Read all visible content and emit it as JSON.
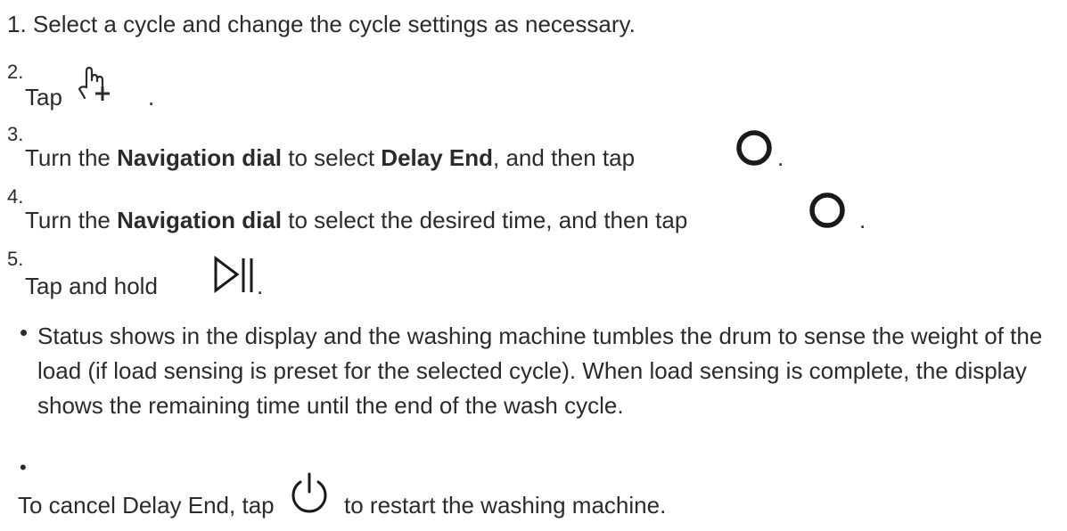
{
  "steps": [
    {
      "num": "1.",
      "text": "Select a cycle and change the cycle settings as necessary."
    },
    {
      "num": "2.",
      "pre": "Tap",
      "post": "."
    },
    {
      "num": "3.",
      "pre": "Turn the ",
      "bold1": "Navigation dial",
      "mid": " to select ",
      "bold2": "Delay End",
      "post": ", and then tap",
      "end": "."
    },
    {
      "num": "4.",
      "pre": "Turn the ",
      "bold1": "Navigation dial",
      "mid": " to select the desired time, and then tap",
      "end": "."
    },
    {
      "num": "5.",
      "pre": "Tap and hold",
      "end": "."
    }
  ],
  "bullets": [
    {
      "mark": "•",
      "text": "Status shows in the display and the washing machine tumbles the drum to sense the weight of the load (if load sensing is preset for the selected cycle). When load sensing is complete, the display shows the remaining time until the end of the wash cycle."
    },
    {
      "mark": "•",
      "pre": "To cancel Delay End, tap",
      "post": "to restart the washing machine."
    }
  ],
  "icons": {
    "step2": "hand-tap-plus-icon",
    "step3": "circle-icon",
    "step4": "circle-icon",
    "step5": "play-pause-icon",
    "cancel": "power-icon"
  }
}
